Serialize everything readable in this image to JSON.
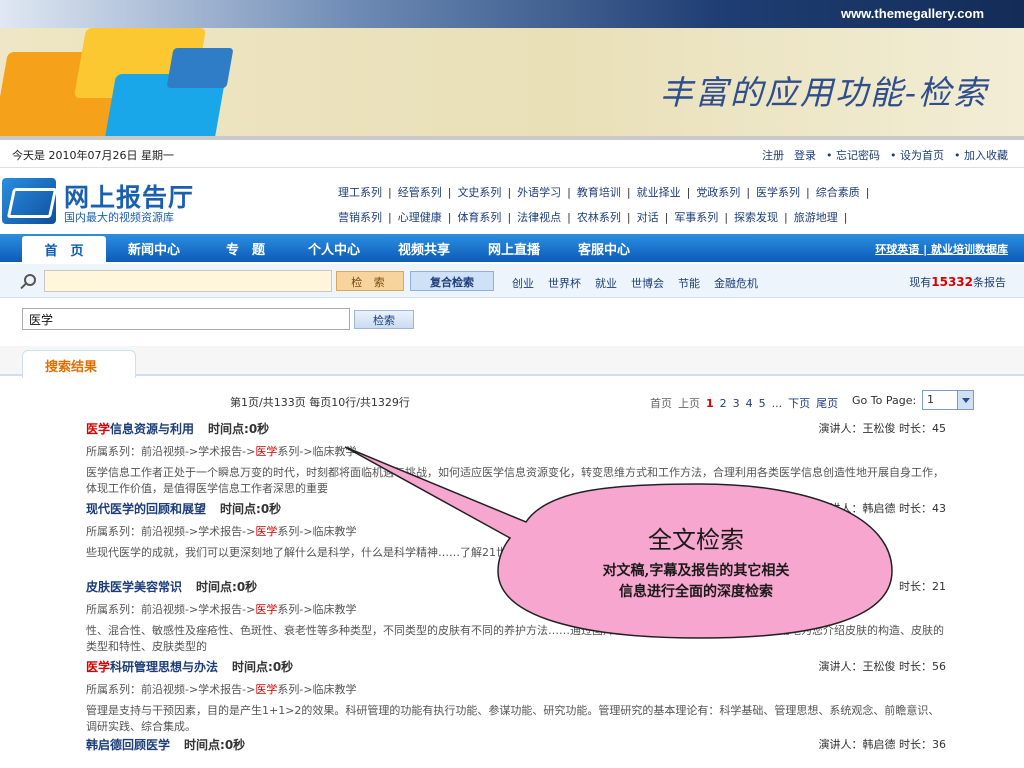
{
  "slide": {
    "url": "www.themegallery.com",
    "title": "丰富的应用功能-检索"
  },
  "site": {
    "date": "今天是  2010年07月26日  星期一",
    "top_links": [
      "注册",
      "登录",
      "• 忘记密码",
      "• 设为首页",
      "• 加入收藏"
    ],
    "logo_name": "网上报告厅",
    "logo_tag": "国内最大的视频资源库",
    "categories_row1": [
      "理工系列",
      "经管系列",
      "文史系列",
      "外语学习",
      "教育培训",
      "就业择业",
      "党政系列",
      "医学系列",
      "综合素质"
    ],
    "categories_row2": [
      "营销系列",
      "心理健康",
      "体育系列",
      "法律视点",
      "农林系列",
      "对话",
      "军事系列",
      "探索发现",
      "旅游地理"
    ],
    "nav_home": "首　页",
    "nav_items": [
      "新闻中心",
      "专　题",
      "个人中心",
      "视频共享",
      "网上直播",
      "客服中心"
    ],
    "nav_right": "环球英语 | 就业培训数据库",
    "search_btn": "检 索",
    "adv_btn": "复合检索",
    "hot_words": [
      "创业",
      "世界杯",
      "就业",
      "世博会",
      "节能",
      "金融危机"
    ],
    "count_prefix": "现有",
    "count_value": "15332",
    "count_suffix": "条报告",
    "query_value": "医学",
    "query_btn": "检索",
    "tab_label": "搜索结果"
  },
  "pager": {
    "summary": "第1页/共133页  每页10行/共1329行",
    "first": "首页",
    "prev": "上页",
    "current": "1",
    "pages": [
      "2",
      "3",
      "4",
      "5",
      "..."
    ],
    "next": "下页",
    "last": "尾页",
    "goto_label": "Go To Page:",
    "goto_value": "1"
  },
  "results": [
    {
      "title_hl": "医学",
      "title_rest": "信息资源与利用",
      "time": "时间点:0秒",
      "speaker": "演讲人：王松俊  时长：45",
      "series_pre": "所属系列：前沿视频->学术报告->",
      "series_hl": "医学",
      "series_post": "系列->临床教学",
      "desc": "医学信息工作者正处于一个瞬息万变的时代，时刻都将面临机遇与挑战，如何适应医学信息资源变化，转变思维方式和工作方法，合理利用各类医学信息创造性地开展自身工作，体现工作价值，是值得医学信息工作者深思的重要"
    },
    {
      "title_hl": "",
      "title_rest": "现代医学的回顾和展望",
      "time": "时间点:0秒",
      "speaker": "演讲人：韩启德  时长：43",
      "series_pre": "所属系列：前沿视频->学术报告->",
      "series_hl": "医学",
      "series_post": "系列->临床教学",
      "desc": "些现代医学的成就，我们可以更深刻地了解什么是科学，什么是科学精神……了解21世纪的医学发展依然取决于整个现代科学的发展，21世纪的医学也一定"
    },
    {
      "title_hl": "",
      "title_rest": "皮肤医学美容常识",
      "time": "时间点:0秒",
      "speaker": "时长：21",
      "series_pre": "所属系列：前沿视频->学术报告->",
      "series_hl": "医学",
      "series_post": "系列->临床教学",
      "desc": "性、混合性、敏感性及痤疮性、色斑性、衰老性等多种类型，不同类型的皮肤有不同的养护方法……通过图片、动画、现场演示和解说，详细生动地为您介绍皮肤的构造、皮肤的类型和特性、皮肤类型的"
    },
    {
      "title_hl": "医学",
      "title_rest": "科研管理思想与办法",
      "time": "时间点:0秒",
      "speaker": "演讲人：王松俊  时长：56",
      "series_pre": "所属系列：前沿视频->学术报告->",
      "series_hl": "医学",
      "series_post": "系列->临床教学",
      "desc": "管理是支持与干预因素，目的是产生1+1>2的效果。科研管理的功能有执行功能、参谋功能、研究功能。管理研究的基本理论有：科学基础、管理思想、系统观念、前瞻意识、调研实践、综合集成。"
    },
    {
      "title_hl": "",
      "title_rest": "韩启德回顾医学",
      "time": "时间点:0秒",
      "speaker": "演讲人：韩启德  时长：36",
      "series_pre": "",
      "series_hl": "",
      "series_post": "",
      "desc": ""
    }
  ],
  "callout": {
    "heading": "全文检索",
    "line1": "对文稿,字幕及报告的其它相关",
    "line2": "信息进行全面的深度检索",
    "fill": "#f7a6cf",
    "stroke": "#222222"
  }
}
